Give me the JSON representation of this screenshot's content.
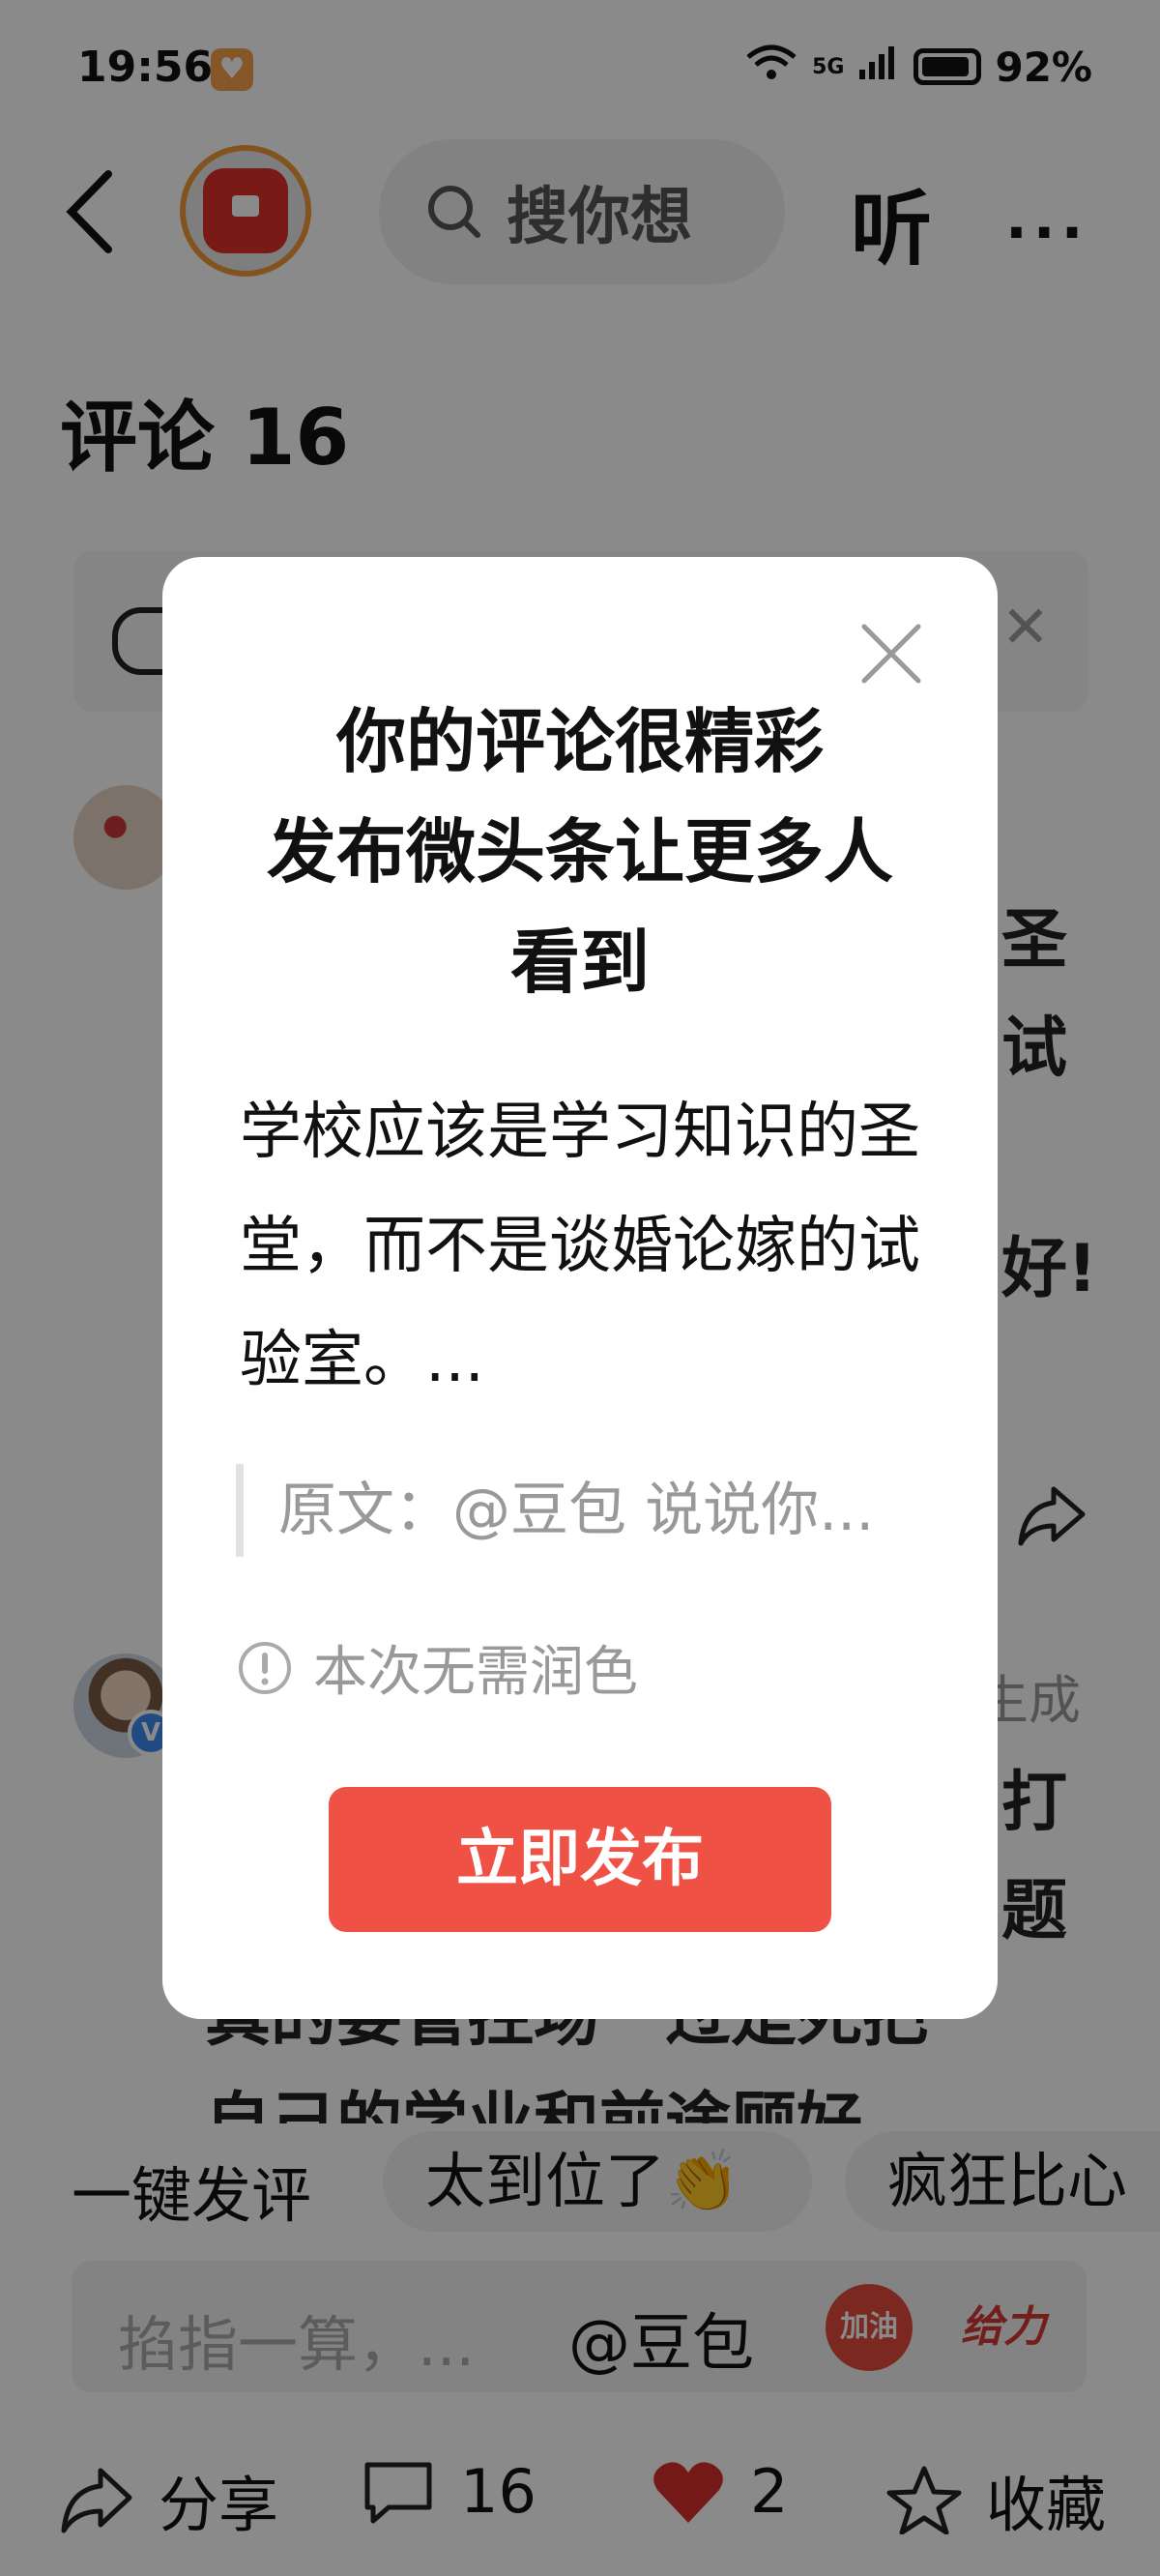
{
  "status_bar": {
    "time": "19:56",
    "network": "5G",
    "battery": "92%"
  },
  "top_nav": {
    "search_placeholder": "搜你想",
    "listen_label": "听",
    "more_label": "···"
  },
  "comments": {
    "title": "评论 16",
    "partial_texts": [
      "圣",
      "试",
      "好!",
      "生成",
      "打",
      "题"
    ],
    "partial_lines": [
      "真的要管控场一过是死把",
      "自己的学业和前途顾好"
    ]
  },
  "quick_reply": {
    "label": "一键发评",
    "chips": [
      "太到位了👏",
      "疯狂比心"
    ]
  },
  "input_bar": {
    "placeholder": "掐指一算，...",
    "mention": "@豆包",
    "stickers": [
      "加油",
      "给力"
    ]
  },
  "bottom_bar": {
    "share_label": "分享",
    "comment_count": "16",
    "like_count": "2",
    "fav_label": "收藏"
  },
  "modal": {
    "title_lines": [
      "你的评论很精彩",
      "发布微头条让更多人",
      "看到"
    ],
    "body": "学校应该是学习知识的圣堂，而不是谈婚论嫁的试验室。...",
    "quote": "原文：@豆包 说说你...",
    "notice": "本次无需润色",
    "publish_button": "立即发布"
  },
  "colors": {
    "accent": "#ef5245",
    "overlay": "rgba(0,0,0,0.46)",
    "like": "#d9302a"
  }
}
